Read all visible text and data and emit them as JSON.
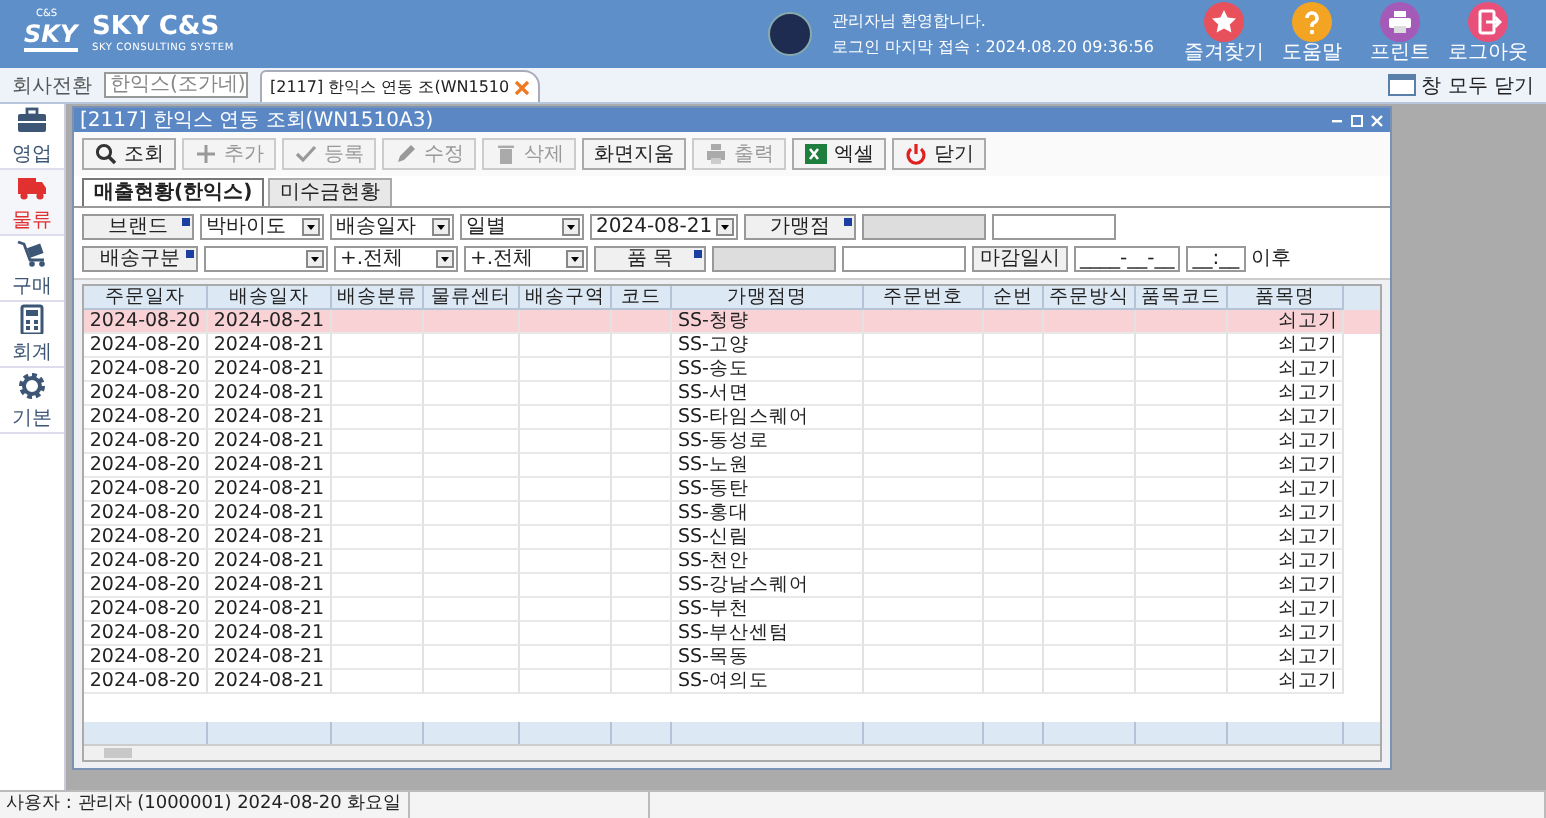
{
  "header": {
    "logo_badge": "C&S",
    "logo_mark": "SKY",
    "brand": "SKY C&S",
    "tagline": "SKY CONSULTING SYSTEM",
    "welcome": "관리자님 환영합니다.",
    "last_login": "로그인 마지막 접속 : 2024.08.20 09:36:56",
    "actions": [
      {
        "label": "즐겨찾기",
        "kind": "star",
        "color": "#e8505b"
      },
      {
        "label": "도움말",
        "kind": "help",
        "color": "#f4a423"
      },
      {
        "label": "프린트",
        "kind": "print",
        "color": "#a45bb8"
      },
      {
        "label": "로그아웃",
        "kind": "logout",
        "color": "#e8507a"
      }
    ]
  },
  "subbar": {
    "company_label": "회사전환",
    "company": "한익스(조가네)",
    "tabs": [
      {
        "label": "[2117] 한익스 연동 조(WN1510",
        "selected": true
      }
    ],
    "close_all": "창 모두 닫기"
  },
  "sidebar": {
    "items": [
      {
        "label": "영업",
        "kind": "briefcase",
        "selected": false
      },
      {
        "label": "물류",
        "kind": "truck",
        "selected": true
      },
      {
        "label": "구매",
        "kind": "cart",
        "selected": false
      },
      {
        "label": "회계",
        "kind": "calculator",
        "selected": false
      },
      {
        "label": "기본",
        "kind": "gear",
        "selected": false
      }
    ]
  },
  "window": {
    "title": "[2117] 한익스 연동 조회(WN1510A3)",
    "toolbar": [
      {
        "label": "조회",
        "kind": "search",
        "disabled": false
      },
      {
        "label": "추가",
        "kind": "plus",
        "disabled": true
      },
      {
        "label": "등록",
        "kind": "check",
        "disabled": true
      },
      {
        "label": "수정",
        "kind": "pencil",
        "disabled": true
      },
      {
        "label": "삭제",
        "kind": "trash",
        "disabled": true
      },
      {
        "label": "화면지움",
        "kind": "none",
        "disabled": false
      },
      {
        "label": "출력",
        "kind": "print",
        "disabled": true
      },
      {
        "label": "엑셀",
        "kind": "excel",
        "disabled": false
      },
      {
        "label": "닫기",
        "kind": "power",
        "disabled": false
      }
    ],
    "tabs": [
      {
        "label": "매출현황(한익스)",
        "selected": true
      },
      {
        "label": "미수금현황",
        "selected": false
      }
    ],
    "filters": [
      [
        {
          "kind": "button",
          "label": "브랜드"
        },
        {
          "kind": "select",
          "value": "박바이도"
        },
        {
          "kind": "select",
          "value": "배송일자"
        },
        {
          "kind": "select",
          "value": "일별"
        },
        {
          "kind": "select",
          "value": "2024-08-21"
        },
        {
          "kind": "button",
          "label": "가맹점"
        },
        {
          "kind": "field",
          "disabled": true
        },
        {
          "kind": "field",
          "disabled": false
        }
      ],
      [
        {
          "kind": "button",
          "label": "배송구분"
        },
        {
          "kind": "select"
        },
        {
          "kind": "select",
          "value": "+.전체"
        },
        {
          "kind": "select",
          "value": "+.전체"
        },
        {
          "kind": "button",
          "label": "품 목"
        },
        {
          "kind": "field",
          "disabled": true
        },
        {
          "kind": "field",
          "disabled": false
        },
        {
          "kind": "label",
          "label": "마감일시"
        },
        {
          "kind": "field",
          "value": "____-__-__",
          "disabled": false
        },
        {
          "kind": "field",
          "value": "__:__",
          "disabled": false
        },
        {
          "kind": "text",
          "label": "이후"
        }
      ]
    ],
    "table": {
      "columns": [
        "주문일자",
        "배송일자",
        "배송분류",
        "물류센터",
        "배송구역",
        "코드",
        "가맹점명",
        "주문번호",
        "순번",
        "주문방식",
        "품목코드",
        "품목명"
      ],
      "rows": [
        {
          "order_date": "2024-08-20",
          "ship_date": "2024-08-21",
          "store": "SS-청량",
          "item_name": "쇠고기",
          "selected": true
        },
        {
          "order_date": "2024-08-20",
          "ship_date": "2024-08-21",
          "store": "SS-고양",
          "item_name": "쇠고기",
          "selected": false
        },
        {
          "order_date": "2024-08-20",
          "ship_date": "2024-08-21",
          "store": "SS-송도",
          "item_name": "쇠고기",
          "selected": false
        },
        {
          "order_date": "2024-08-20",
          "ship_date": "2024-08-21",
          "store": "SS-서면",
          "item_name": "쇠고기",
          "selected": false
        },
        {
          "order_date": "2024-08-20",
          "ship_date": "2024-08-21",
          "store": "SS-타임스퀘어",
          "item_name": "쇠고기",
          "selected": false
        },
        {
          "order_date": "2024-08-20",
          "ship_date": "2024-08-21",
          "store": "SS-동성로",
          "item_name": "쇠고기",
          "selected": false
        },
        {
          "order_date": "2024-08-20",
          "ship_date": "2024-08-21",
          "store": "SS-노원",
          "item_name": "쇠고기",
          "selected": false
        },
        {
          "order_date": "2024-08-20",
          "ship_date": "2024-08-21",
          "store": "SS-동탄",
          "item_name": "쇠고기",
          "selected": false
        },
        {
          "order_date": "2024-08-20",
          "ship_date": "2024-08-21",
          "store": "SS-홍대",
          "item_name": "쇠고기",
          "selected": false
        },
        {
          "order_date": "2024-08-20",
          "ship_date": "2024-08-21",
          "store": "SS-신림",
          "item_name": "쇠고기",
          "selected": false
        },
        {
          "order_date": "2024-08-20",
          "ship_date": "2024-08-21",
          "store": "SS-천안",
          "item_name": "쇠고기",
          "selected": false
        },
        {
          "order_date": "2024-08-20",
          "ship_date": "2024-08-21",
          "store": "SS-강남스퀘어",
          "item_name": "쇠고기",
          "selected": false
        },
        {
          "order_date": "2024-08-20",
          "ship_date": "2024-08-21",
          "store": "SS-부천",
          "item_name": "쇠고기",
          "selected": false
        },
        {
          "order_date": "2024-08-20",
          "ship_date": "2024-08-21",
          "store": "SS-부산센텀",
          "item_name": "쇠고기",
          "selected": false
        },
        {
          "order_date": "2024-08-20",
          "ship_date": "2024-08-21",
          "store": "SS-목동",
          "item_name": "쇠고기",
          "selected": false
        },
        {
          "order_date": "2024-08-20",
          "ship_date": "2024-08-21",
          "store": "SS-여의도",
          "item_name": "쇠고기",
          "selected": false
        }
      ]
    }
  },
  "status_bar": {
    "user": "사용자 : 관리자 (1000001) 2024-08-20 화요일"
  }
}
